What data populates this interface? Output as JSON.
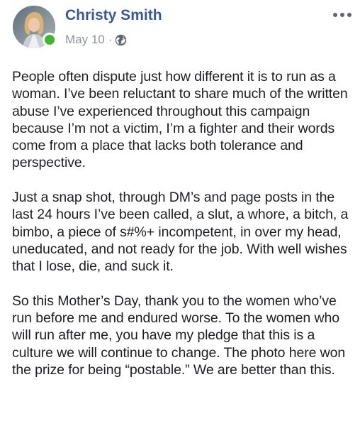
{
  "post": {
    "author": "Christy Smith",
    "date": "May 10",
    "separator": "·",
    "privacy_icon": "globe-icon",
    "more_icon": "more-options-icon",
    "paragraphs": [
      "People often dispute just how different it is to run as a woman. I’ve been reluctant to share much of the written abuse I’ve experienced throughout this campaign because I’m not a victim, I’m a fighter and their words come from a place that lacks both tolerance and perspective.",
      "Just a snap shot, through DM’s and page posts in the last 24 hours I’ve been called, a slut, a whore, a bitch, a bimbo, a piece of s#%+ incompetent, in over my head, uneducated, and not ready for the job. With well wishes that I lose, die, and suck it.",
      "So this Mother’s Day, thank you to the women who’ve run before me and endured worse. To the women who will run after me, you have my pledge that this is a culture we will continue to change. The photo here won the prize for being “postable.” We are better than this."
    ]
  },
  "colors": {
    "author_link": "#385898",
    "meta_gray": "#90949c",
    "online_green": "#42b72a",
    "text": "#1c1e21"
  }
}
